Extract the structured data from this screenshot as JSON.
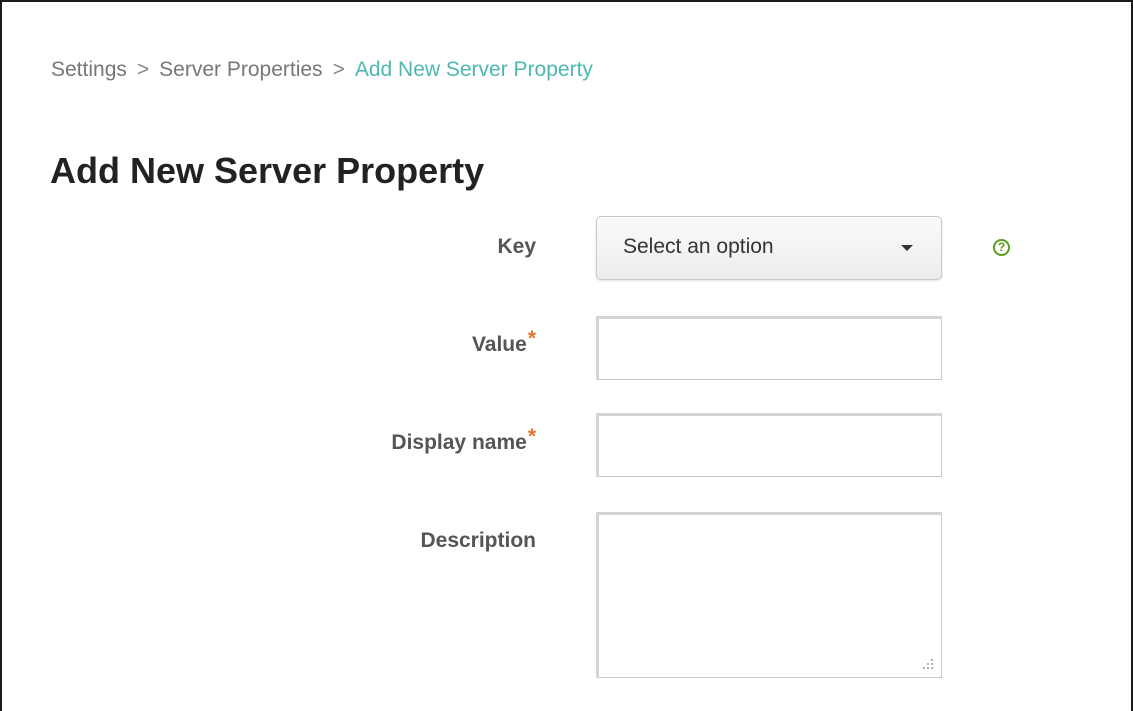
{
  "breadcrumb": {
    "items": [
      {
        "label": "Settings"
      },
      {
        "label": "Server Properties"
      },
      {
        "label": "Add New Server Property"
      }
    ],
    "separator": ">"
  },
  "page": {
    "title": "Add New Server Property"
  },
  "form": {
    "key": {
      "label": "Key",
      "selected": "Select an option",
      "help_icon": "question-circle-icon"
    },
    "value": {
      "label": "Value",
      "required_mark": "*",
      "value": ""
    },
    "display_name": {
      "label": "Display name",
      "required_mark": "*",
      "value": ""
    },
    "description": {
      "label": "Description",
      "value": ""
    }
  },
  "colors": {
    "breadcrumb_current": "#4cb8b1",
    "required_mark": "#e8742c",
    "help_icon": "#5a9e1f"
  }
}
